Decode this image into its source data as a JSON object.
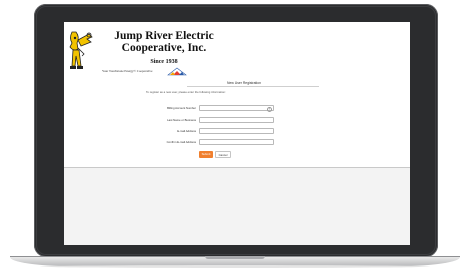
{
  "header": {
    "brand_line1": "Jump River Electric",
    "brand_line2": "Cooperative, Inc.",
    "since": "Since 1938",
    "tagline": "Your Touchstone Energy® Cooperative",
    "touchstone_logo_text": "K"
  },
  "form": {
    "title": "New User Registration",
    "intro": "To register as a new user, please enter the following information:",
    "fields": [
      {
        "label": "Billing Account Number",
        "value": "",
        "help_icon": "?"
      },
      {
        "label": "Last Name or Business",
        "value": ""
      },
      {
        "label": "E-mail Address",
        "value": ""
      },
      {
        "label": "Confirm E-mail Address",
        "value": ""
      }
    ],
    "submit_label": "Submit",
    "cancel_label": "Cancel"
  },
  "colors": {
    "accent": "#f07f2e",
    "laptop_frame": "#2b2c2e",
    "logo_yellow": "#f2c300"
  },
  "icons": {
    "logo": "cooperative-mascot-icon",
    "help": "question-mark-icon",
    "touchstone": "touchstone-energy-logo"
  }
}
